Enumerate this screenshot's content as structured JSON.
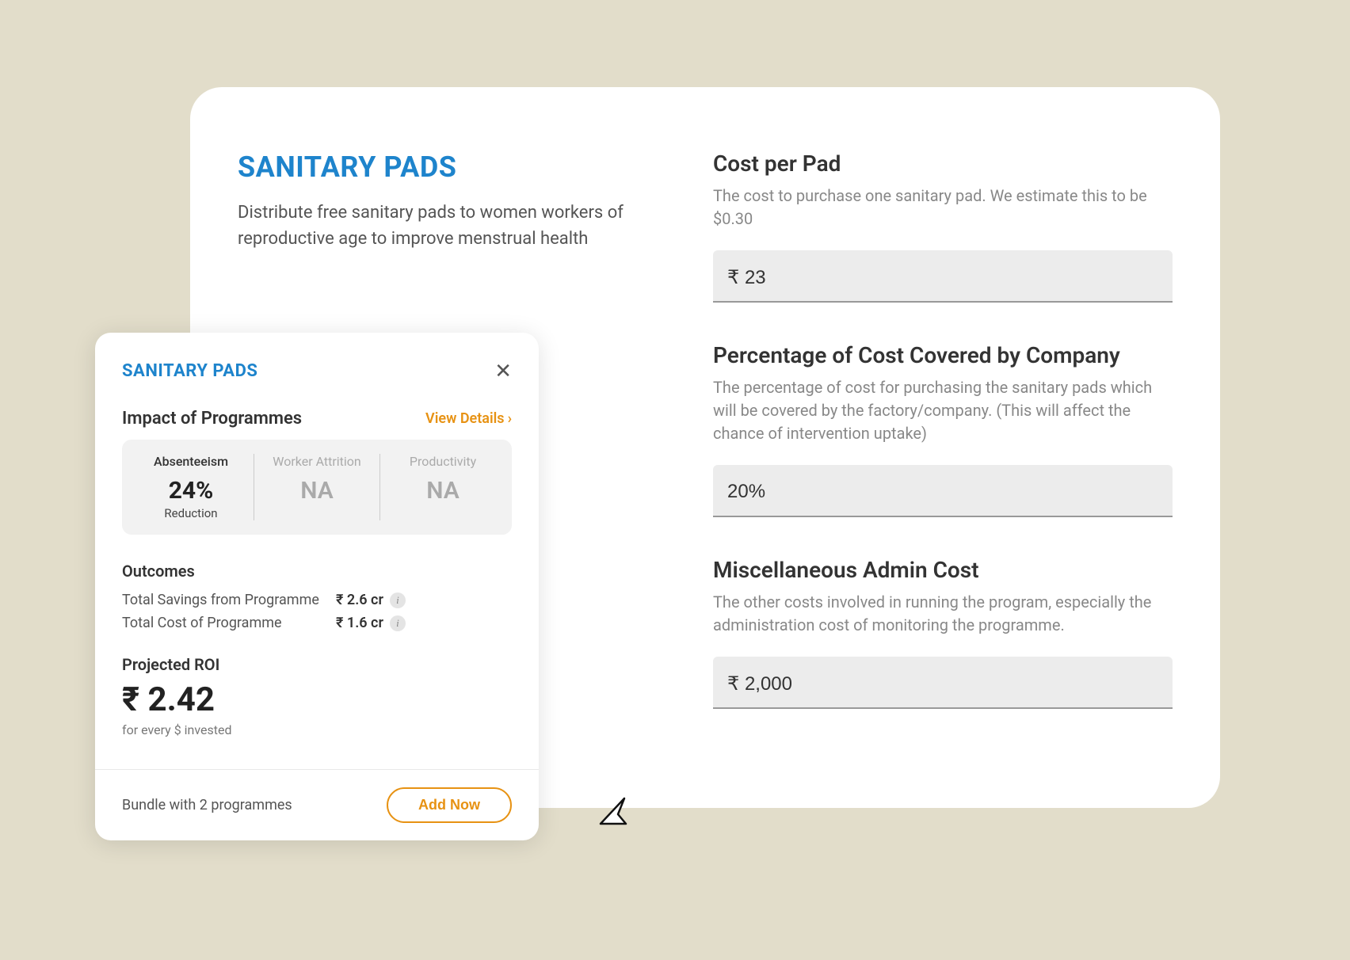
{
  "main": {
    "title": "SANITARY PADS",
    "description": "Distribute free sanitary pads to women workers of reproductive age to improve menstrual health",
    "fields": {
      "cost_per_pad": {
        "label": "Cost per Pad",
        "help": "The cost to purchase one sanitary pad. We estimate this to be $0.30",
        "value": "₹ 23"
      },
      "pct_covered": {
        "label": "Percentage of Cost Covered by Company",
        "help": "The percentage of cost for purchasing the sanitary pads which will be covered by the factory/company. (This will affect the chance of intervention uptake)",
        "value": "20%"
      },
      "admin_cost": {
        "label": "Miscellaneous Admin Cost",
        "help": "The other costs involved in running the program, especially the administration cost of monitoring the programme.",
        "value": "₹ 2,000"
      }
    }
  },
  "popup": {
    "title": "SANITARY PADS",
    "impact_title": "Impact of Programmes",
    "view_details": "View Details",
    "metrics": {
      "absenteeism": {
        "label": "Absenteeism",
        "value": "24%",
        "sub": "Reduction"
      },
      "attrition": {
        "label": "Worker Attrition",
        "value": "NA"
      },
      "productivity": {
        "label": "Productivity",
        "value": "NA"
      }
    },
    "outcomes_title": "Outcomes",
    "outcomes": {
      "savings": {
        "label": "Total Savings from Programme",
        "value": "₹ 2.6 cr"
      },
      "cost": {
        "label": "Total Cost of Programme",
        "value": "₹ 1.6 cr"
      }
    },
    "roi": {
      "title": "Projected ROI",
      "value": "₹ 2.42",
      "sub": "for every $ invested"
    },
    "bundle_text": "Bundle with 2 programmes",
    "add_now": "Add Now"
  }
}
